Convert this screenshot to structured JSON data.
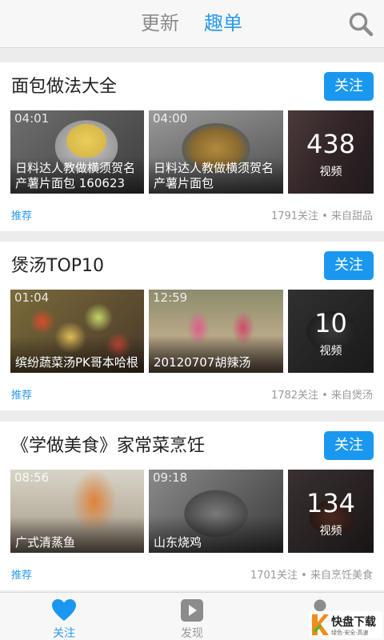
{
  "header": {
    "tabs": [
      {
        "label": "更新",
        "active": false
      },
      {
        "label": "趣单",
        "active": true
      }
    ],
    "search_icon": "search-icon"
  },
  "accent_color": "#1a98f0",
  "cards": [
    {
      "title": "面包做法大全",
      "follow_label": "关注",
      "videos": [
        {
          "duration": "04:01",
          "title": "日料达人教做横须贺名产薯片面包 160623"
        },
        {
          "duration": "04:00",
          "title": "日料达人教做横须贺名产薯片面包"
        }
      ],
      "more": {
        "count": "438",
        "label": "视频"
      },
      "tag": "推荐",
      "meta": "1791关注 • 来自甜品"
    },
    {
      "title": "煲汤TOP10",
      "follow_label": "关注",
      "videos": [
        {
          "duration": "01:04",
          "title": "缤纷蔬菜汤PK哥本哈根"
        },
        {
          "duration": "12:59",
          "title": "20120707胡辣汤"
        }
      ],
      "more": {
        "count": "10",
        "label": "视频"
      },
      "tag": "推荐",
      "meta": "1782关注 • 来自煲汤"
    },
    {
      "title": "《学做美食》家常菜烹饪",
      "follow_label": "关注",
      "videos": [
        {
          "duration": "08:56",
          "title": "广式清蒸鱼"
        },
        {
          "duration": "09:18",
          "title": "山东烧鸡"
        }
      ],
      "more": {
        "count": "134",
        "label": "视频"
      },
      "tag": "推荐",
      "meta": "1701关注 • 来自烹饪美食"
    }
  ],
  "bottom_nav": [
    {
      "label": "关注",
      "icon": "heart-icon",
      "active": true
    },
    {
      "label": "发现",
      "icon": "play-icon",
      "active": false
    },
    {
      "label": "我的",
      "icon": "user-icon",
      "active": false
    }
  ],
  "watermark": {
    "text": "快盘下载",
    "sub": "绿色·安全·高速"
  }
}
